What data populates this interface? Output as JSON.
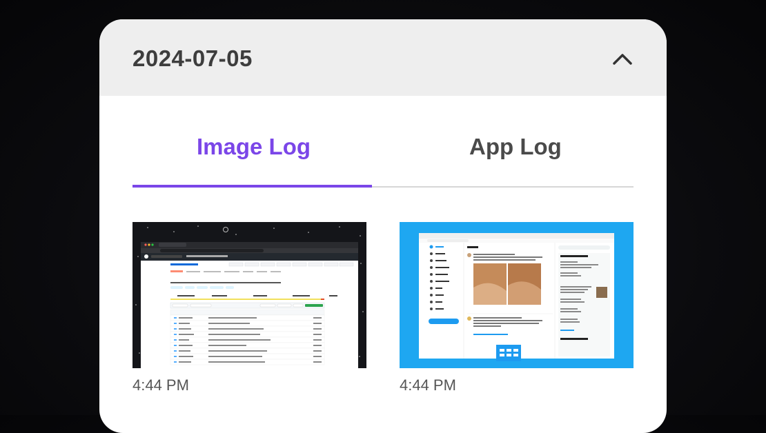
{
  "header": {
    "date": "2024-07-05"
  },
  "tabs": [
    {
      "label": "Image Log",
      "active": true
    },
    {
      "label": "App Log",
      "active": false
    }
  ],
  "entries": [
    {
      "time": "4:44 PM",
      "thumbnail": "github-repository-screenshot"
    },
    {
      "time": "4:44 PM",
      "thumbnail": "twitter-home-screenshot"
    }
  ],
  "colors": {
    "accent": "#7b46e8",
    "header_bg": "#eeeeee",
    "twitter_bg": "#1ea7f1"
  },
  "icons": {
    "collapse": "chevron-up-icon"
  }
}
